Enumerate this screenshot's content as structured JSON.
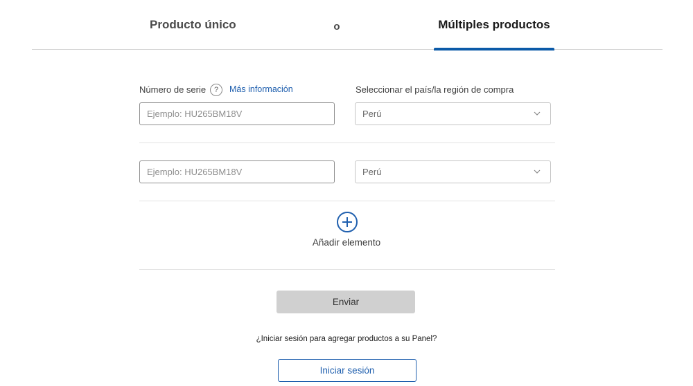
{
  "tabs": {
    "single": "Producto único",
    "separator": "o",
    "multiple": "Múltiples productos",
    "active": "multiple"
  },
  "form": {
    "serial_label": "Número de serie",
    "help_icon_text": "?",
    "more_info": "Más información",
    "country_label": "Seleccionar el país/la región de compra",
    "rows": [
      {
        "serial_placeholder": "Ejemplo: HU265BM18V",
        "serial_value": "",
        "country": "Perú"
      },
      {
        "serial_placeholder": "Ejemplo: HU265BM18V",
        "serial_value": "",
        "country": "Perú"
      }
    ],
    "add_label": "Añadir elemento",
    "submit_label": "Enviar"
  },
  "signin": {
    "prompt": "¿Iniciar sesión para agregar productos a su Panel?",
    "button_label": "Iniciar sesión"
  },
  "colors": {
    "accent": "#0b5aa8",
    "link": "#1f5fae",
    "disabled_button": "#d0d0d0"
  },
  "icons": {
    "help": "question-circle-icon",
    "select_chevron": "chevron-down-icon",
    "add": "plus-circle-icon"
  }
}
